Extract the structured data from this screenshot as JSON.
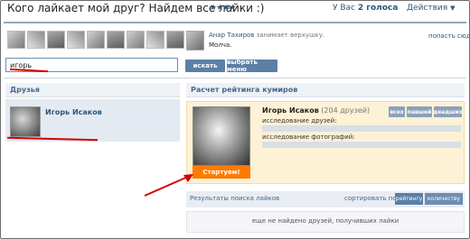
{
  "header": {
    "title": "Кого лайкает мой друг? Найдем все лайки :)",
    "stars": "★★★★",
    "votes_prefix": "У Вас ",
    "votes_count": "2 голоса",
    "actions_label": "Действия",
    "actions_chevron": "▼"
  },
  "friend_thumbnails_count": 10,
  "feed": {
    "author": "Анар Тахиров",
    "action": " занимает верхушку.",
    "status": "Молча.",
    "link": "попасть сюда"
  },
  "search": {
    "value": "игорь",
    "search_button": "искать",
    "choose_button": "выбрать меню"
  },
  "friends_panel": {
    "title": "Друзья",
    "items": [
      {
        "name": "Игорь Исаков"
      }
    ]
  },
  "rating_panel": {
    "title": "Расчет рейтинга кумиров",
    "idol_name": "Игорь Исаков",
    "idol_count": " (204 друзей)",
    "sort_buttons": [
      "всех",
      "павшей",
      "двадших"
    ],
    "progress": [
      {
        "label": "исследование друзей:",
        "value": 0
      },
      {
        "label": "исследование фотографий:",
        "value": 0
      }
    ],
    "start_button": "Стартуем!"
  },
  "results": {
    "title": "Результаты поиска лайков",
    "sort_label": "сортировать по",
    "sort_rating": "рейтингу",
    "sort_count": "количеству",
    "empty_message": "еще не найдено друзей, получивших лайки"
  },
  "colors": {
    "link": "#2b587a",
    "button": "#5b7fa6",
    "start": "#ff7a00",
    "annotation": "#d40000",
    "card": "#fdf1d6"
  }
}
